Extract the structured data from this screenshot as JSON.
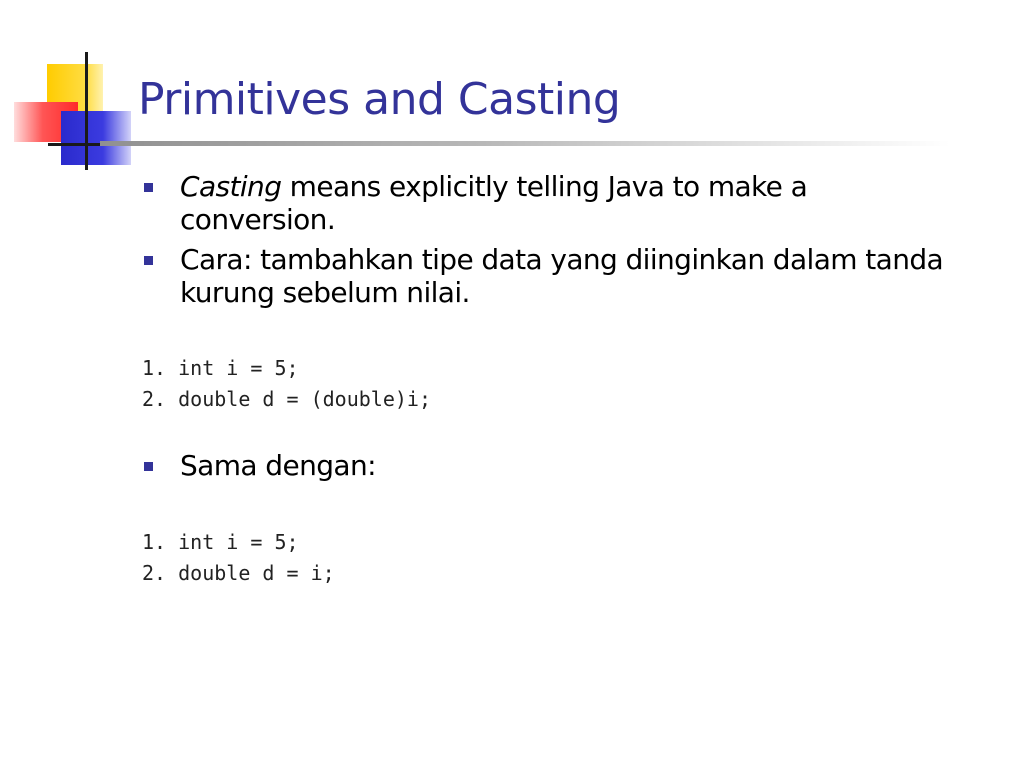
{
  "slide": {
    "title": "Primitives and Casting",
    "bullets_top": [
      {
        "emphasis": "Casting",
        "text": " means explicitly telling Java to make a conversion."
      },
      {
        "emphasis": "",
        "text": "Cara: tambahkan tipe data yang diinginkan dalam tanda kurung sebelum nilai."
      }
    ],
    "code_block_1": [
      "1. int i = 5;",
      "2. double d = (double)i;"
    ],
    "bullets_bottom": [
      {
        "text": "Sama dengan:"
      }
    ],
    "code_block_2": [
      "1. int i = 5;",
      "2. double d = i;"
    ]
  },
  "colors": {
    "title": "#333399",
    "bullet_marker": "#333399",
    "logo_yellow": "#ffcc00",
    "logo_red": "#ff3333",
    "logo_blue": "#3333cc"
  }
}
